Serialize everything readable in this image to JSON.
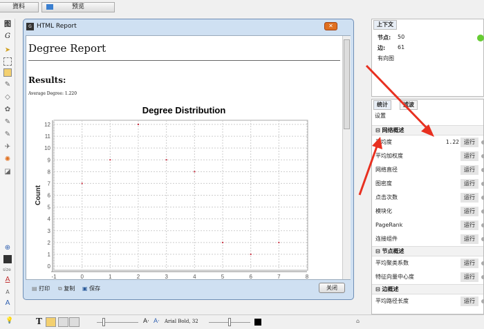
{
  "top_toolbar": {
    "data_button": "資料",
    "preview_button": "预览"
  },
  "left_toolbar": {
    "graph_label": "图",
    "size_label": "size"
  },
  "dialog": {
    "title": "HTML Report",
    "report_title": "Degree Report",
    "results_heading": "Results:",
    "average_degree_text": "Average Degree: 1.220",
    "print_label": "打印",
    "copy_label": "复制",
    "save_label": "保存",
    "close_label": "关闭"
  },
  "context_panel": {
    "tab": "上下文",
    "nodes_label": "节点:",
    "nodes_value": "50",
    "edges_label": "边:",
    "edges_value": "61",
    "graph_type": "有向图"
  },
  "stats_panel": {
    "tabs": [
      "统计",
      "滤波"
    ],
    "settings": "设置",
    "run_label": "运行",
    "categories": [
      {
        "label": "网络概述",
        "items": [
          {
            "label": "平均度",
            "value": "1.22"
          },
          {
            "label": "平均加权度"
          },
          {
            "label": "网络直径"
          },
          {
            "label": "图密度"
          },
          {
            "label": "点击次数"
          },
          {
            "label": "模块化"
          },
          {
            "label": "PageRank"
          },
          {
            "label": "连接组件"
          }
        ]
      },
      {
        "label": "节点概述",
        "items": [
          {
            "label": "平均聚类系数"
          },
          {
            "label": "特征向量中心度"
          }
        ]
      },
      {
        "label": "边概述",
        "items": [
          {
            "label": "平均路径长度"
          }
        ]
      }
    ]
  },
  "bottom_toolbar": {
    "font_label": "Arial Bold, 32"
  },
  "colors": {
    "point": "#cc3344",
    "arrow": "#e83020",
    "close_button": "#e07020"
  },
  "chart_data": {
    "type": "scatter",
    "title": "Degree Distribution",
    "xlabel": "",
    "ylabel": "Count",
    "xlim": [
      -1,
      8
    ],
    "ylim": [
      0,
      12
    ],
    "x_ticks": [
      -1,
      0,
      1,
      2,
      3,
      4,
      5,
      6,
      7,
      8
    ],
    "y_ticks": [
      0,
      1,
      2,
      3,
      4,
      5,
      6,
      7,
      8,
      9,
      10,
      11,
      12
    ],
    "grid": true,
    "x": [
      0,
      1,
      2,
      3,
      4,
      5,
      6,
      7
    ],
    "y": [
      7,
      9,
      12,
      9,
      8,
      2,
      1,
      2
    ]
  }
}
